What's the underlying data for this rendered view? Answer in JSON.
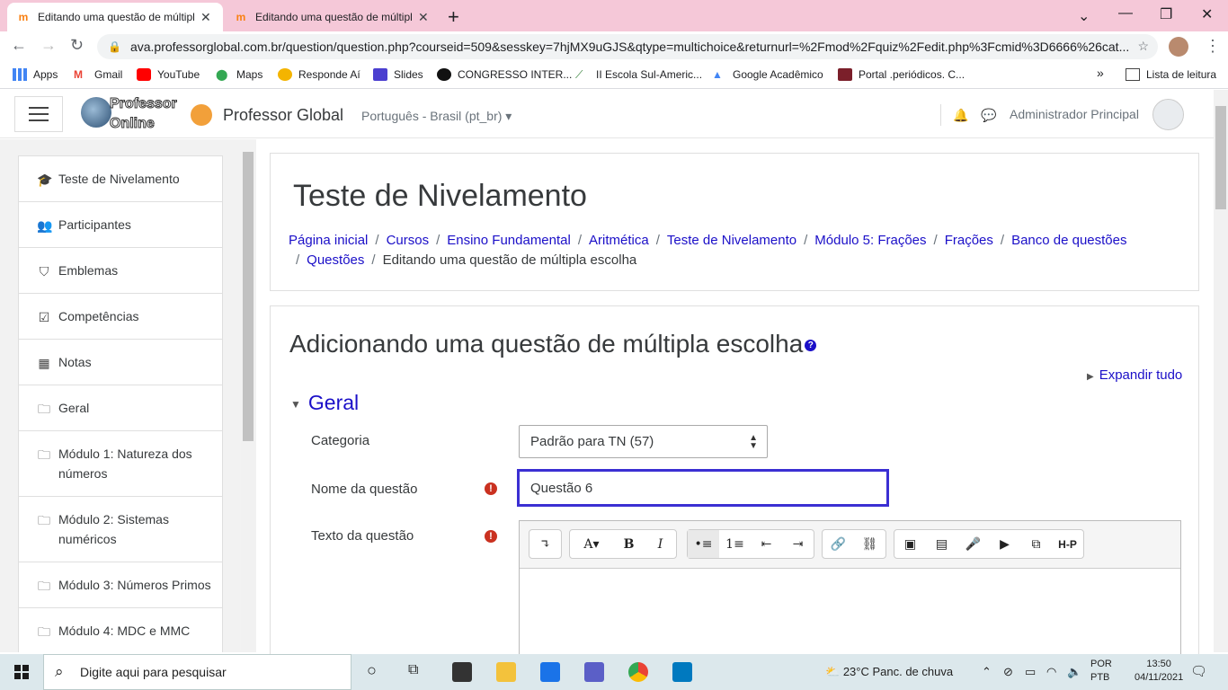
{
  "browser": {
    "tabs": [
      {
        "title": "Editando uma questão de múltipla escolha",
        "favicon": "m"
      },
      {
        "title": "Editando uma questão de múltipla escolha",
        "favicon": "m"
      }
    ],
    "url": "ava.professorglobal.com.br/question/question.php?courseid=509&sesskey=7hjMX9uGJS&qtype=multichoice&returnurl=%2Fmod%2Fquiz%2Fedit.php%3Fcmid%3D6666%26cat...",
    "bookmarks": [
      "Apps",
      "Gmail",
      "YouTube",
      "Maps",
      "Responde Aí",
      "Slides",
      "CONGRESSO INTER...",
      "II Escola Sul-Americ...",
      "Google Acadêmico",
      "Portal .periódicos. C..."
    ],
    "more_bookmarks": "»",
    "reading_list": "Lista de leitura"
  },
  "header": {
    "logo_text": "Professor Online",
    "site_name": "Professor Global",
    "language": "Português - Brasil (pt_br) ▾",
    "user_name": "Administrador Principal"
  },
  "nav": {
    "items": [
      {
        "label": "Teste de Nivelamento",
        "icon": "graduation-cap-icon",
        "glyph": "🎓"
      },
      {
        "label": "Participantes",
        "icon": "users-icon",
        "glyph": "👥"
      },
      {
        "label": "Emblemas",
        "icon": "shield-icon",
        "glyph": "⛉"
      },
      {
        "label": "Competências",
        "icon": "checkbox-icon",
        "glyph": "☑"
      },
      {
        "label": "Notas",
        "icon": "table-icon",
        "glyph": "▦"
      },
      {
        "label": "Geral",
        "icon": "folder-icon",
        "glyph": "🗀"
      },
      {
        "label": "Módulo 1: Natureza dos números",
        "icon": "folder-icon",
        "glyph": "🗀"
      },
      {
        "label": "Módulo 2: Sistemas numéricos",
        "icon": "folder-icon",
        "glyph": "🗀"
      },
      {
        "label": "Módulo 3: Números Primos",
        "icon": "folder-icon",
        "glyph": "🗀"
      },
      {
        "label": "Módulo 4: MDC e MMC",
        "icon": "folder-icon",
        "glyph": "🗀"
      }
    ]
  },
  "page": {
    "title": "Teste de Nivelamento",
    "breadcrumb": [
      "Página inicial",
      "Cursos",
      "Ensino Fundamental",
      "Aritmética",
      "Teste de Nivelamento",
      "Módulo 5: Frações",
      "Frações",
      "Banco de questões",
      "Questões"
    ],
    "breadcrumb_current": "Editando uma questão de múltipla escolha"
  },
  "form": {
    "heading": "Adicionando uma questão de múltipla escolha",
    "expand_all": "Expandir tudo",
    "section": "Geral",
    "category_label": "Categoria",
    "category_value": "Padrão para TN (57)",
    "name_label": "Nome da questão",
    "name_value": "Questão 6",
    "text_label": "Texto da questão",
    "required_mark": "!",
    "editor_tools": [
      "↴",
      "A▾",
      "B",
      "I",
      "•≡",
      "1≡",
      "⇤",
      "⇥",
      "🔗",
      "⛓",
      "▣",
      "▤",
      "🎤",
      "▶",
      "⧉",
      "H-P"
    ]
  },
  "taskbar": {
    "search_placeholder": "Digite aqui para pesquisar",
    "weather": "23°C  Panc. de chuva",
    "lang": "POR",
    "layout": "PTB",
    "time": "13:50",
    "date": "04/11/2021"
  },
  "colors": {
    "link": "#1b0fc8",
    "required": "#ca3120",
    "tab_strip": "#f5c8d8",
    "focus_border": "#3b2fd3"
  }
}
